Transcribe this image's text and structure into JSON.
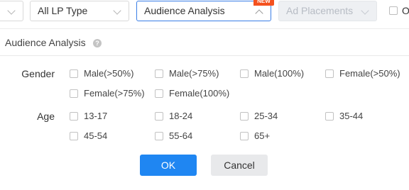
{
  "filters": {
    "lp_type": "All LP Type",
    "audience": "Audience Analysis",
    "new_badge": "NEW",
    "ad_placements": "Ad Placements",
    "trailing_checkbox_label": "O"
  },
  "panel": {
    "title": "Audience Analysis",
    "help": "?"
  },
  "gender": {
    "label": "Gender",
    "options": [
      "Male(>50%)",
      "Male(>75%)",
      "Male(100%)",
      "Female(>50%)",
      "Female(>75%)",
      "Female(100%)"
    ]
  },
  "age": {
    "label": "Age",
    "options": [
      "13-17",
      "18-24",
      "25-34",
      "35-44",
      "45-54",
      "55-64",
      "65+"
    ]
  },
  "actions": {
    "ok": "OK",
    "cancel": "Cancel"
  },
  "colors": {
    "primary": "#1f86f2",
    "active_border": "#3a7ee6",
    "badge": "#f4511e"
  }
}
